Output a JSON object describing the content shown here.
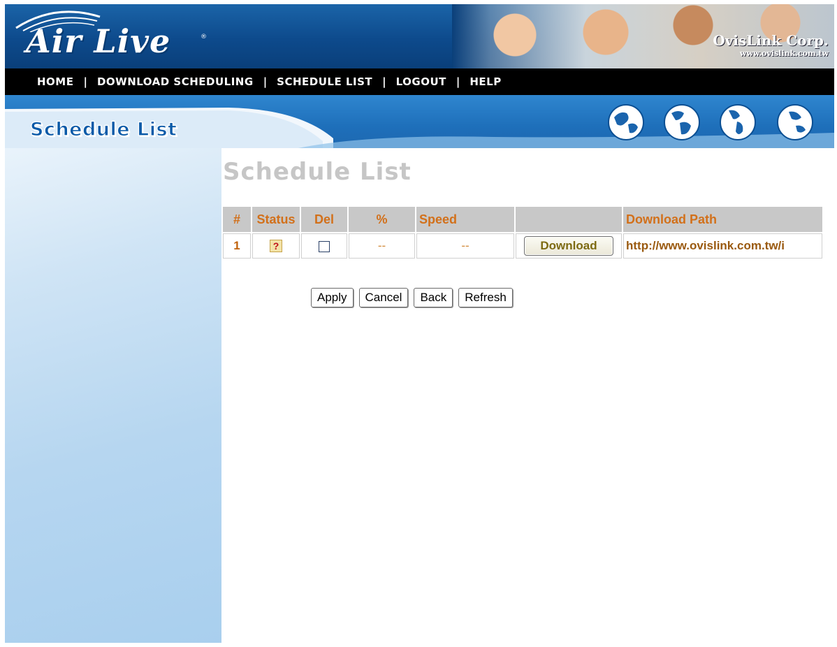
{
  "header": {
    "logo_text": "Air Live",
    "logo_reg": "®",
    "company_name": "OvisLink Corp.",
    "company_url": "www.ovislink.com.tw"
  },
  "nav": {
    "items": [
      "HOME",
      "DOWNLOAD SCHEDULING",
      "SCHEDULE LIST",
      "LOGOUT",
      "HELP"
    ],
    "separator": "|"
  },
  "banner": {
    "title": "Schedule List"
  },
  "main": {
    "title": "Schedule List",
    "table": {
      "headers": [
        "#",
        "Status",
        "Del",
        "%",
        "Speed",
        "",
        "Download Path"
      ],
      "rows": [
        {
          "num": "1",
          "status_icon": "?",
          "del_checked": false,
          "percent": "--",
          "speed": "--",
          "button_label": "Download",
          "path": "http://www.ovislink.com.tw/i"
        }
      ]
    },
    "buttons": {
      "apply": "Apply",
      "cancel": "Cancel",
      "back": "Back",
      "refresh": "Refresh"
    }
  },
  "colors": {
    "header_blue": "#0d4a8c",
    "nav_black": "#000000",
    "table_header_text": "#d2701a",
    "title_gray": "#c6c6c6"
  }
}
